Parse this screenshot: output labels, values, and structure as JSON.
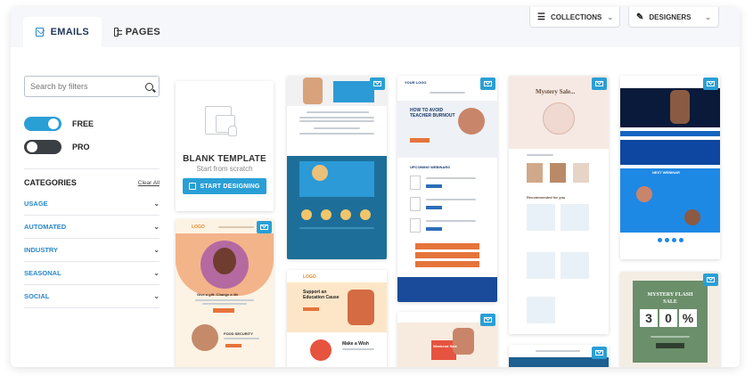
{
  "tabs": [
    {
      "label": "EMAILS",
      "active": true,
      "icon": "envelope-icon"
    },
    {
      "label": "PAGES",
      "active": false,
      "icon": "page-icon"
    }
  ],
  "dropdowns": {
    "collections": {
      "label": "COLLECTIONS",
      "icon": "layers-icon"
    },
    "designers": {
      "label": "DESIGNERS",
      "icon": "designer-icon"
    }
  },
  "search": {
    "placeholder": "Search by filters"
  },
  "toggles": {
    "free": {
      "label": "FREE",
      "on": true
    },
    "pro": {
      "label": "PRO",
      "on": false
    }
  },
  "categories": {
    "title": "CATEGORIES",
    "clear_label": "Clear All",
    "items": [
      "USAGE",
      "AUTOMATED",
      "INDUSTRY",
      "SEASONAL",
      "SOCIAL"
    ]
  },
  "blank_template": {
    "title": "BLANK TEMPLATE",
    "subtitle": "Start from scratch",
    "button": "START DESIGNING"
  },
  "thumbnails": {
    "logo_text": "LOGO",
    "give_gift": "Give a gift. Change a life",
    "food_security": "FOOD SECURITY",
    "support_education": "Support an Education Cause",
    "make_a_wish": "Make a Wish",
    "blank_brand": "YOUR LOGO",
    "teacher_burnout": "HOW TO AVOID TEACHER BURNOUT",
    "upcoming_webinars": "UPCOMING WEBINARS",
    "mystery_sale": "Mystery Sale...",
    "recommended": "Recommended for you",
    "weekend_sale": "Weekend Sale",
    "mystery_flash": "MYSTERY FLASH SALE",
    "flash_digits": [
      "3",
      "0",
      "%"
    ],
    "webinar_title": "NEXT WEBINAR"
  },
  "colors": {
    "accent": "#2a9fd6",
    "category_link": "#2a88c9",
    "toggle_off": "#3a3f44"
  }
}
